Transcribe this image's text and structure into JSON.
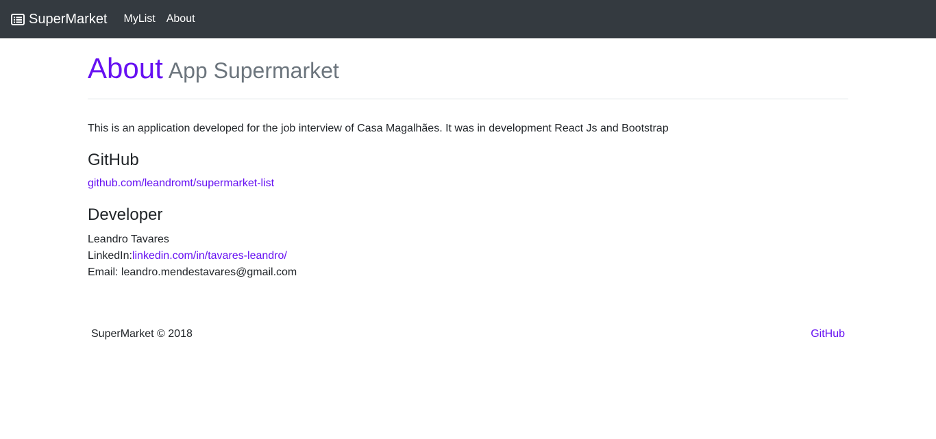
{
  "navbar": {
    "brand": "SuperMarket",
    "brand_icon": "list-alt-icon",
    "links": [
      "MyList",
      "About"
    ]
  },
  "header": {
    "title": "About",
    "subtitle": "App Supermarket"
  },
  "content": {
    "description": "This is an application developed for the job interview of Casa Magalhães. It was in development React Js and Bootstrap",
    "github_heading": "GitHub",
    "github_link": "github.com/leandromt/supermarket-list",
    "developer_heading": "Developer",
    "developer_name": "Leandro Tavares",
    "linkedin_label": "LinkedIn:",
    "linkedin_link": "linkedin.com/in/tavares-leandro/",
    "email_line": "Email: leandro.mendestavares@gmail.com"
  },
  "footer": {
    "copyright": "SuperMarket © 2018",
    "github_link": "GitHub"
  },
  "colors": {
    "navbar_bg": "#343a40",
    "accent": "#6610f2",
    "muted": "#6c757d"
  }
}
